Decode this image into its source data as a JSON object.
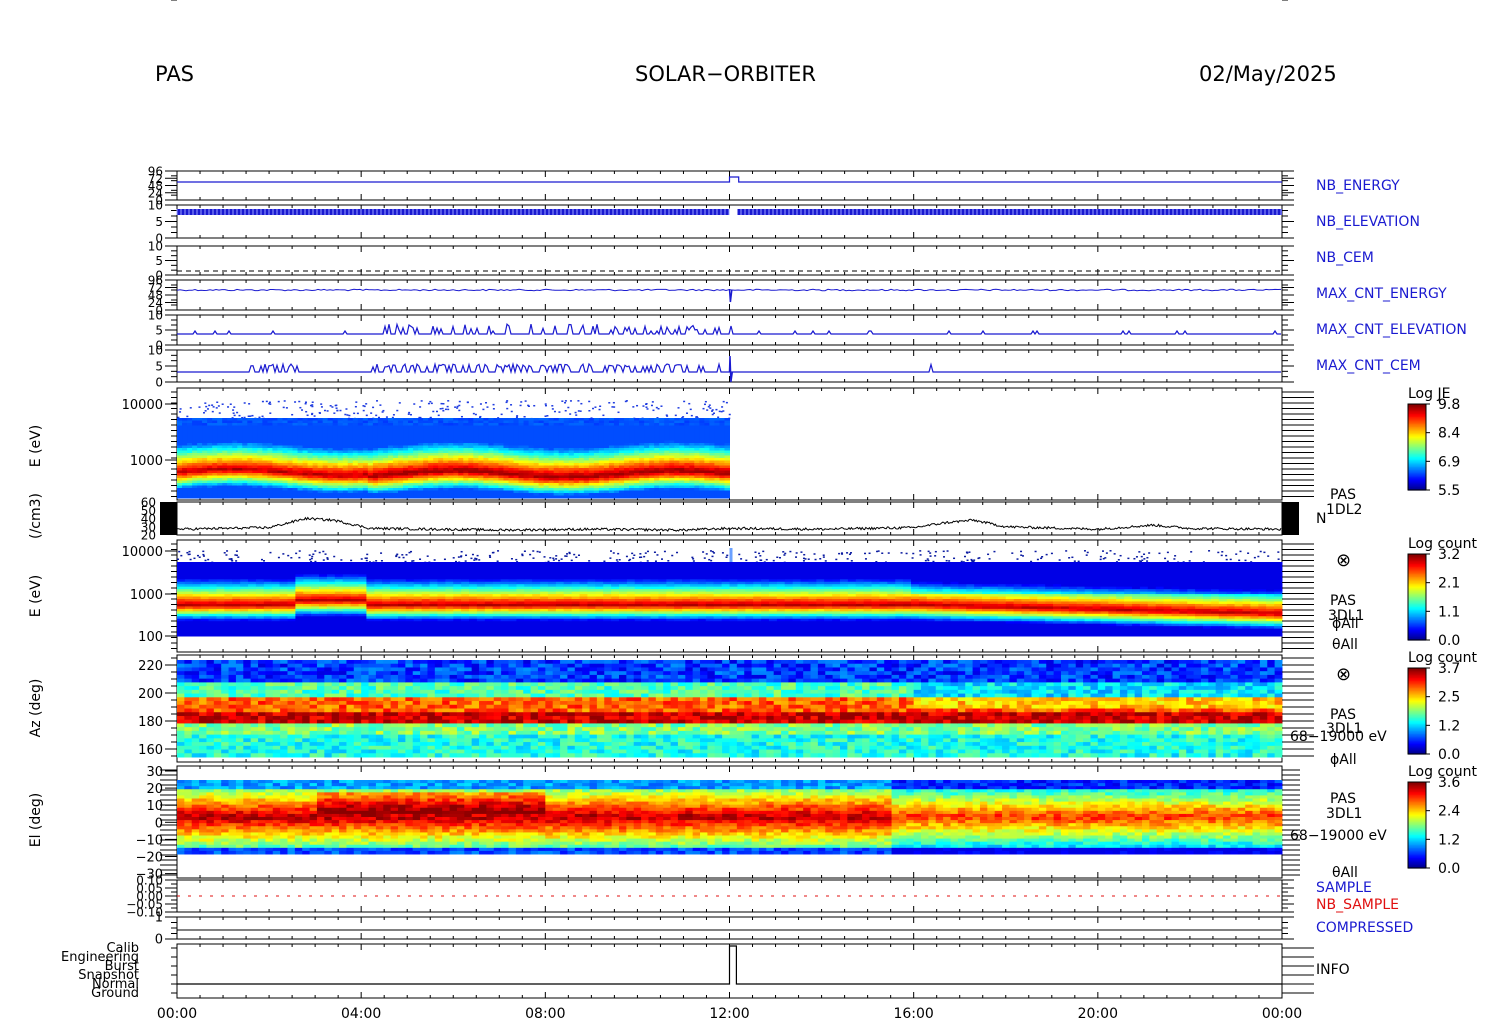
{
  "header": {
    "instrument": "PAS",
    "mission": "SOLAR−ORBITER",
    "date": "02/May/2025"
  },
  "colors": {
    "blue_trace": "#1a1ad0",
    "red_trace": "#e01010",
    "black": "#000000"
  },
  "chart_data": {
    "type": "heatmap",
    "x_axis": {
      "range": [
        "00:00",
        "24:00"
      ],
      "tick_labels": [
        "00:00",
        "04:00",
        "08:00",
        "12:00",
        "16:00",
        "20:00",
        "00:00"
      ],
      "tick_hours": [
        0,
        4,
        8,
        12,
        16,
        20,
        24
      ]
    },
    "panels": [
      {
        "id": "nb_energy",
        "label": "NB_ENERGY",
        "label_color": "blue",
        "type": "step",
        "y_ticks": [
          "96",
          "72",
          "48",
          "24",
          "0"
        ],
        "step_up_hour": 12.0
      },
      {
        "id": "nb_elevation",
        "label": "NB_ELEVATION",
        "label_color": "blue",
        "type": "line",
        "y_ticks": [
          "10",
          "5",
          "0"
        ]
      },
      {
        "id": "nb_cem",
        "label": "NB_CEM",
        "label_color": "blue",
        "type": "line",
        "y_ticks": [
          "10",
          "5",
          "0"
        ]
      },
      {
        "id": "max_cnt_energy",
        "label": "MAX_CNT_ENERGY",
        "label_color": "blue",
        "type": "line",
        "y_ticks": [
          "96",
          "72",
          "48",
          "24",
          "0"
        ]
      },
      {
        "id": "max_cnt_elevation",
        "label": "MAX_CNT_ELEVATION",
        "label_color": "blue",
        "type": "line",
        "y_ticks": [
          "10",
          "5",
          "0"
        ]
      },
      {
        "id": "max_cnt_cem",
        "label": "MAX_CNT_CEM",
        "label_color": "blue",
        "type": "line",
        "y_ticks": [
          "10",
          "5",
          "0"
        ]
      },
      {
        "id": "energy_spectrogram_1",
        "type": "heatmap",
        "ylabel": "E (eV)",
        "y_ticks": [
          "10000",
          "1000"
        ],
        "colorbar": {
          "title": "Log JE",
          "ticks": [
            "9.8",
            "8.4",
            "6.9",
            "5.5"
          ],
          "range": [
            5.5,
            9.8
          ]
        },
        "data_end_hour": 12.0
      },
      {
        "id": "density",
        "type": "line",
        "ylabel": "(/cm3)",
        "y_ticks": [
          "60",
          "50",
          "40",
          "30",
          "20"
        ],
        "side_labels": [
          "PAS",
          "1DL2",
          "N"
        ],
        "profile_hour": [
          0,
          2,
          2.8,
          3.4,
          4.2,
          7,
          9,
          11,
          12,
          14,
          16,
          16.7,
          17.3,
          18,
          20,
          21.2,
          22,
          24
        ],
        "profile_value": [
          27,
          29,
          40,
          38,
          28,
          26,
          27,
          26,
          28,
          27,
          29,
          35,
          38,
          30,
          27,
          32,
          28,
          27
        ]
      },
      {
        "id": "energy_spectrogram_2",
        "type": "heatmap",
        "ylabel": "E (eV)",
        "y_ticks": [
          "10000",
          "1000",
          "100"
        ],
        "side_labels": [
          "⊗",
          "PAS",
          "3DL1",
          "ϕAll",
          "θAll"
        ],
        "colorbar": {
          "title": "Log count",
          "ticks": [
            "3.2",
            "2.1",
            "1.1",
            "0.0"
          ],
          "range": [
            0.0,
            3.2
          ]
        }
      },
      {
        "id": "azimuth_spectrogram",
        "type": "heatmap",
        "ylabel": "Az (deg)",
        "y_ticks": [
          "220",
          "200",
          "180",
          "160"
        ],
        "side_labels": [
          "⊗",
          "PAS",
          "3DL1",
          "68−19000 eV",
          "ϕAll"
        ],
        "colorbar": {
          "title": "Log count",
          "ticks": [
            "3.7",
            "2.5",
            "1.2",
            "0.0"
          ],
          "range": [
            0.0,
            3.7
          ]
        }
      },
      {
        "id": "elevation_spectrogram",
        "type": "heatmap",
        "ylabel": "El (deg)",
        "y_ticks": [
          "30",
          "20",
          "10",
          "0",
          "−10",
          "−20",
          "−30"
        ],
        "side_labels": [
          "PAS",
          "3DL1",
          "68−19000 eV",
          "θAll"
        ],
        "colorbar": {
          "title": "Log count",
          "ticks": [
            "3.6",
            "2.4",
            "1.2",
            "0.0"
          ],
          "range": [
            0.0,
            3.6
          ]
        }
      },
      {
        "id": "sample",
        "labels": [
          "SAMPLE",
          "NB_SAMPLE"
        ],
        "type": "line",
        "y_ticks": [
          "0.10",
          "0.05",
          "0.00",
          "−0.05",
          "−0.10"
        ]
      },
      {
        "id": "compressed",
        "label": "COMPRESSED",
        "label_color": "blue",
        "type": "line",
        "y_ticks": [
          "1",
          "0"
        ]
      },
      {
        "id": "info",
        "label": "INFO",
        "label_color": "black",
        "type": "step",
        "y_ticks": [
          "Calib",
          "Engineering",
          "Burst",
          "Snapshot",
          "Normal",
          "Ground"
        ],
        "step_hour": 12.0
      }
    ]
  }
}
